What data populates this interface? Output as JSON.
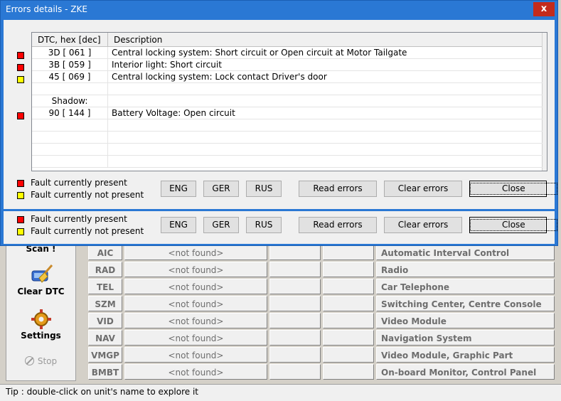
{
  "dialog": {
    "title": "Errors details - ZKE",
    "close_glyph": "x",
    "columns": [
      "DTC, hex [dec]",
      "Description"
    ],
    "rows": [
      {
        "dtc": "3D [ 061 ]",
        "desc": "Central locking system: Short circuit or Open circuit at Motor Tailgate",
        "status": "red"
      },
      {
        "dtc": "3B [ 059 ]",
        "desc": "Interior light: Short circuit",
        "status": "red"
      },
      {
        "dtc": "45 [ 069 ]",
        "desc": "Central locking system: Lock contact Driver's door",
        "status": "yellow"
      },
      {
        "dtc": "",
        "desc": "",
        "status": ""
      },
      {
        "dtc": "Shadow:",
        "desc": "",
        "status": ""
      },
      {
        "dtc": "90 [ 144 ]",
        "desc": "Battery Voltage: Open circuit",
        "status": "red"
      },
      {
        "dtc": "",
        "desc": "",
        "status": ""
      },
      {
        "dtc": "",
        "desc": "",
        "status": ""
      },
      {
        "dtc": "",
        "desc": "",
        "status": ""
      },
      {
        "dtc": "",
        "desc": "",
        "status": ""
      }
    ],
    "legend": {
      "present": "Fault currently present",
      "not_present": "Fault currently not present"
    },
    "buttons": {
      "eng": "ENG",
      "ger": "GER",
      "rus": "RUS",
      "read": "Read errors",
      "clear": "Clear errors",
      "close": "Close"
    }
  },
  "left_panel": {
    "scan": "Scan !",
    "clear_dtc": "Clear DTC",
    "settings": "Settings",
    "stop": "Stop"
  },
  "units": [
    {
      "name": "AIC",
      "addr": "<not found>",
      "desc": "Automatic Interval Control"
    },
    {
      "name": "RAD",
      "addr": "<not found>",
      "desc": "Radio"
    },
    {
      "name": "TEL",
      "addr": "<not found>",
      "desc": "Car Telephone"
    },
    {
      "name": "SZM",
      "addr": "<not found>",
      "desc": "Switching Center, Centre Console"
    },
    {
      "name": "VID",
      "addr": "<not found>",
      "desc": "Video Module"
    },
    {
      "name": "NAV",
      "addr": "<not found>",
      "desc": "Navigation System"
    },
    {
      "name": "VMGP",
      "addr": "<not found>",
      "desc": "Video Module, Graphic Part"
    },
    {
      "name": "BMBT",
      "addr": "<not found>",
      "desc": "On-board Monitor, Control Panel"
    }
  ],
  "status_bar": "Tip : double-click on unit's name to explore it",
  "colors": {
    "titlebar": "#2a78d4",
    "fault_present": "#ff0000",
    "fault_not_present": "#ffff00"
  }
}
